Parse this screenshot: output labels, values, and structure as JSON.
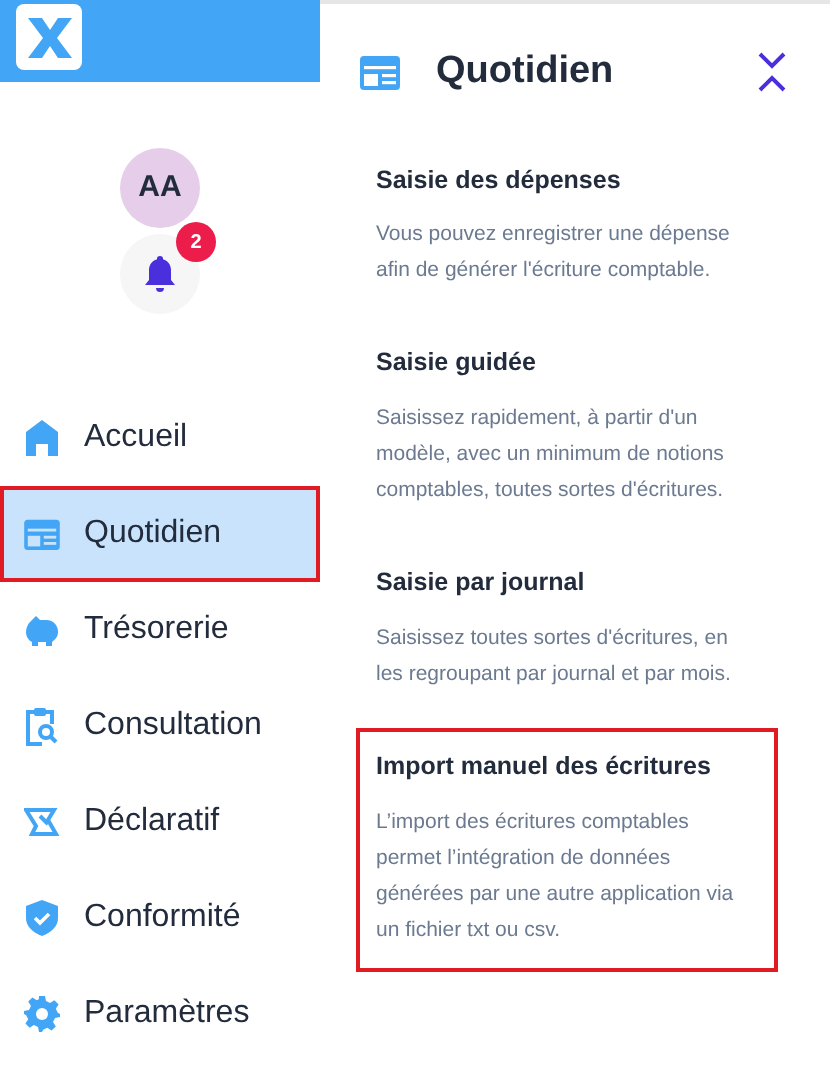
{
  "user": {
    "initials": "AA"
  },
  "notifications": {
    "count": "2"
  },
  "nav": [
    {
      "label": "Accueil",
      "kind": "home",
      "selected": false,
      "highlighted": false
    },
    {
      "label": "Quotidien",
      "kind": "calendar",
      "selected": true,
      "highlighted": true
    },
    {
      "label": "Trésorerie",
      "kind": "piggy",
      "selected": false,
      "highlighted": false
    },
    {
      "label": "Consultation",
      "kind": "clipboard",
      "selected": false,
      "highlighted": false
    },
    {
      "label": "Déclaratif",
      "kind": "declare",
      "selected": false,
      "highlighted": false
    },
    {
      "label": "Conformité",
      "kind": "shield",
      "selected": false,
      "highlighted": false
    },
    {
      "label": "Paramètres",
      "kind": "gear",
      "selected": false,
      "highlighted": false
    }
  ],
  "panel": {
    "title": "Quotidien",
    "items": [
      {
        "title": "Saisie des dépenses",
        "description": "Vous pouvez enregistrer une dépense afin de générer l'écriture comptable.",
        "highlighted": false
      },
      {
        "title": "Saisie guidée",
        "description": "Saisissez rapidement, à partir d'un modèle, avec un minimum de notions comptables, toutes sortes d'écritures.",
        "highlighted": false
      },
      {
        "title": "Saisie par journal",
        "description": "Saisissez toutes sortes d'écritures, en les regroupant par journal et par mois.",
        "highlighted": false
      },
      {
        "title": "Import manuel des écritures",
        "description": "L’import des écritures comptables permet l’intégration de données générées par une autre application via un fichier txt ou csv.",
        "highlighted": true
      }
    ]
  }
}
